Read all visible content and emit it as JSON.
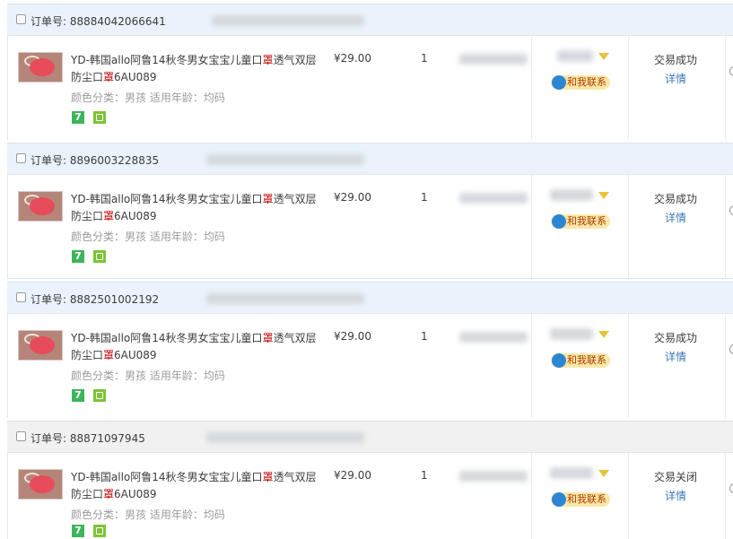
{
  "orders": [
    {
      "order_label": "订单号: 88884042066641",
      "header_bg": "#eaf3fb",
      "product": {
        "title_before": "YD-韩国allo阿鲁14秋冬男女宝宝儿童口",
        "title_highlight": "罩",
        "title_after_1": "透气双层",
        "title_line2_before": "防尘口",
        "title_line2_highlight": "罩",
        "title_line2_after": "6AU089",
        "attributes": "颜色分类：男孩   适用年龄：均码",
        "badge_seven": "7"
      },
      "price": "¥29.00",
      "quantity": "1",
      "contact_label": "和我联系",
      "status": "交易成功",
      "detail_link": "详情"
    },
    {
      "order_label": "订单号: 8896003228835",
      "header_bg": "#eaf3fb",
      "product": {
        "title_before": "YD-韩国allo阿鲁14秋冬男女宝宝儿童口",
        "title_highlight": "罩",
        "title_after_1": "透气双层",
        "title_line2_before": "防尘口",
        "title_line2_highlight": "罩",
        "title_line2_after": "6AU089",
        "attributes": "颜色分类：男孩   适用年龄：均码",
        "badge_seven": "7"
      },
      "price": "¥29.00",
      "quantity": "1",
      "contact_label": "和我联系",
      "status": "交易成功",
      "detail_link": "详情"
    },
    {
      "order_label": "订单号: 8882501002192",
      "header_bg": "#eaf3fb",
      "product": {
        "title_before": "YD-韩国allo阿鲁14秋冬男女宝宝儿童口",
        "title_highlight": "罩",
        "title_after_1": "透气双层",
        "title_line2_before": "防尘口",
        "title_line2_highlight": "罩",
        "title_line2_after": "6AU089",
        "attributes": "颜色分类：男孩   适用年龄：均码",
        "badge_seven": "7"
      },
      "price": "¥29.00",
      "quantity": "1",
      "contact_label": "和我联系",
      "status": "交易成功",
      "detail_link": "详情"
    },
    {
      "order_label": "订单号: 88871097945",
      "header_bg": "#f1f1f1",
      "product": {
        "title_before": "YD-韩国allo阿鲁14秋冬男女宝宝儿童口",
        "title_highlight": "罩",
        "title_after_1": "透气双层",
        "title_line2_before": "防尘口",
        "title_line2_highlight": "罩",
        "title_line2_after": "6AU089",
        "attributes": "颜色分类：男孩   适用年龄：均码",
        "badge_seven": "7"
      },
      "price": "¥29.00",
      "quantity": "1",
      "contact_label": "和我联系",
      "status": "交易关闭",
      "detail_link": "详情"
    }
  ],
  "colors": {
    "header_border": "#d6e4f0",
    "highlight_red": "#c40000",
    "link_blue": "#3c78b8",
    "contact_bg": "#f9e8a8"
  }
}
